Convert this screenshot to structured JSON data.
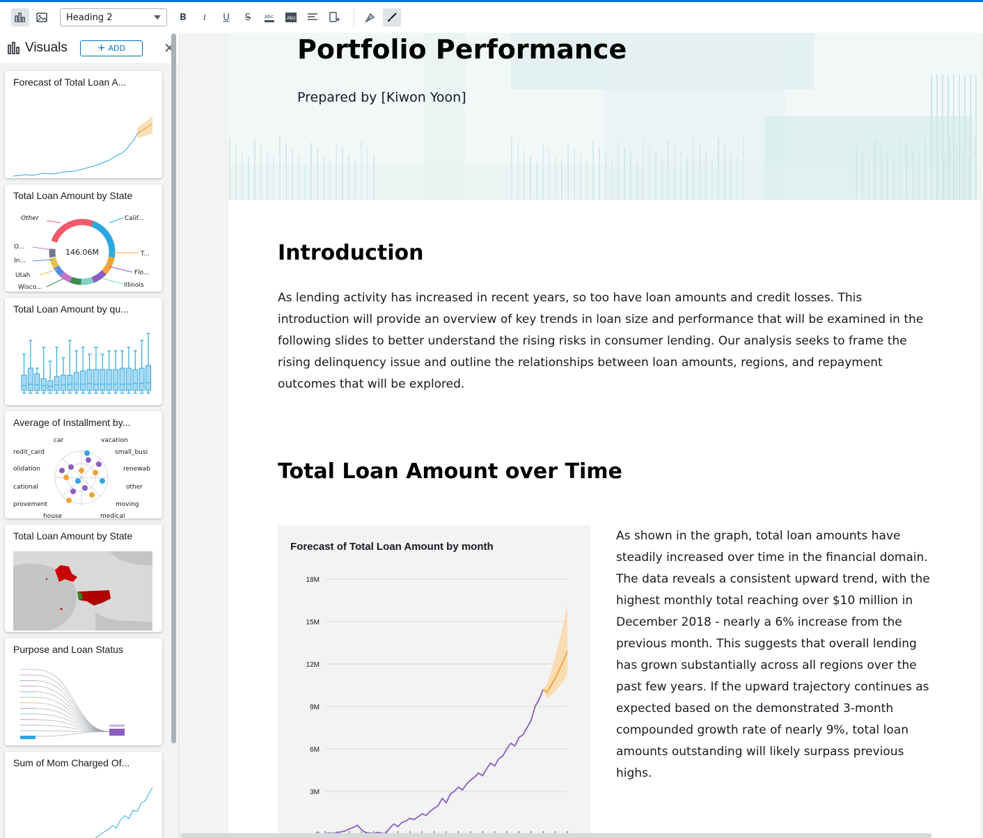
{
  "toolbar": {
    "text_style": "Heading 2",
    "buttons": [
      "chart-icon",
      "image-icon",
      "bold-icon",
      "italic-icon",
      "underline-icon",
      "strikethrough-icon",
      "text-color-icon",
      "highlight-icon",
      "align-icon",
      "insert-icon",
      "format-painter-icon",
      "brush-icon"
    ],
    "bold": "B",
    "italic": "i",
    "underline": "U",
    "strike": "S",
    "abc": "Abc"
  },
  "sidebar": {
    "title": "Visuals",
    "add_label": "ADD",
    "cards": [
      {
        "title": "Forecast of Total Loan A..."
      },
      {
        "title": "Total Loan Amount by State",
        "center_value": "146.06M",
        "labels": [
          "Other",
          "Calif...",
          "O...",
          "In...",
          "T...",
          "Utah",
          "Flo...",
          "Wisco...",
          "Illinois"
        ]
      },
      {
        "title": "Total Loan Amount by qu..."
      },
      {
        "title": "Average of Installment by...",
        "labels": [
          "car",
          "vacation",
          "redit_card",
          "small_busi",
          "olidation",
          "renewab",
          "cational",
          "other",
          "provement",
          "moving",
          "house",
          "medical"
        ]
      },
      {
        "title": "Total Loan Amount by State"
      },
      {
        "title": "Purpose and Loan Status"
      },
      {
        "title": "Sum of Mom Charged Of..."
      }
    ]
  },
  "document": {
    "title": "Portfolio Performance",
    "subtitle": "Prepared by [Kiwon Yoon]",
    "intro_heading": "Introduction",
    "intro_text": "As lending activity has increased in recent years, so too have loan amounts and credit losses. This introduction will provide an overview of key trends in loan size and performance that will be examined in the following slides to better understand the rising risks in consumer lending. Our analysis seeks to frame the rising delinquency issue and outline the relationships between loan amounts, regions, and repayment outcomes that will be explored.",
    "section_heading": "Total Loan Amount over Time",
    "section_text": "As shown in the graph, total loan amounts have steadily increased over time in the financial domain. The data reveals a consistent upward trend, with the highest monthly total reaching over $10 million in December 2018 - nearly a 6% increase from the previous month. This suggests that overall lending has grown substantially across all regions over the past few years. If the upward trajectory continues as expected based on the demonstrated 3-month compounded growth rate of nearly 9%, total loan amounts outstanding will likely surpass previous highs."
  },
  "chart_data": {
    "type": "line",
    "title": "Forecast of Total Loan Amount by month",
    "xlabel": "",
    "ylabel": "",
    "ylim": [
      0,
      18000000
    ],
    "yticks": [
      "0",
      "3M",
      "6M",
      "9M",
      "12M",
      "15M",
      "18M"
    ],
    "ytick_values": [
      0,
      3000000,
      6000000,
      9000000,
      12000000,
      15000000,
      18000000
    ],
    "grid": true,
    "series": [
      {
        "color": "#8b5dbf",
        "values": [
          0.02,
          0.05,
          0.03,
          0.08,
          0.15,
          0.2,
          0.35,
          0.45,
          0.6,
          0.3,
          0.1,
          0.05,
          0.02,
          0.1,
          0.05,
          0.02,
          0.4,
          0.7,
          0.5,
          0.8,
          0.9,
          1.1,
          1.0,
          1.2,
          1.4,
          1.3,
          1.6,
          1.8,
          2.0,
          2.5,
          2.2,
          2.8,
          3.0,
          3.3,
          3.1,
          3.5,
          3.8,
          4.0,
          4.3,
          4.1,
          4.6,
          5.0,
          4.8,
          5.3,
          5.5,
          6.0,
          6.4,
          6.2,
          6.8,
          7.0,
          7.5,
          8.0,
          9.0,
          9.5,
          10.2
        ]
      },
      {
        "name": "",
        "color": "#f2a33a",
        "values": [
          10.2,
          10.0,
          10.5,
          11.0,
          11.6,
          12.2,
          12.9
        ],
        "upper": [
          10.2,
          10.6,
          11.5,
          12.5,
          13.6,
          14.8,
          16.2
        ],
        "lower": [
          10.2,
          9.6,
          9.8,
          10.1,
          10.4,
          10.8,
          11.3
        ]
      }
    ]
  },
  "colors": {
    "accent": "#0972d3",
    "purple": "#8b5dbf",
    "orange": "#f2a33a",
    "blue": "#2ea7e0"
  }
}
